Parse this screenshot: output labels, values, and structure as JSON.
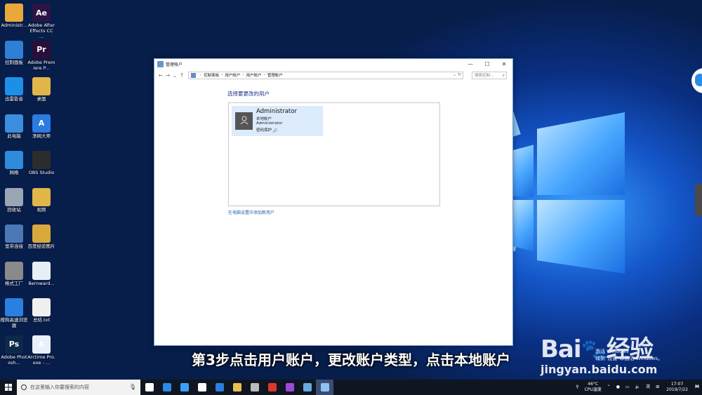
{
  "desktop": {
    "col1": [
      {
        "label": "Administr...",
        "icon": "user-folder-icon",
        "color": "#e8a93a",
        "text": ""
      },
      {
        "label": "控制面板",
        "icon": "control-panel-icon",
        "color": "#2f7fd6",
        "text": ""
      },
      {
        "label": "迅雷影音",
        "icon": "xunlei-player-icon",
        "color": "#1c8fe6",
        "text": ""
      },
      {
        "label": "此电脑",
        "icon": "this-pc-icon",
        "color": "#3b8ede",
        "text": ""
      },
      {
        "label": "网络",
        "icon": "network-icon",
        "color": "#2f8bdc",
        "text": ""
      },
      {
        "label": "回收站",
        "icon": "recycle-bin-icon",
        "color": "#9aa6b4",
        "text": ""
      },
      {
        "label": "宽带连接",
        "icon": "broadband-icon",
        "color": "#4c78b8",
        "text": ""
      },
      {
        "label": "格式工厂",
        "icon": "format-factory-icon",
        "color": "#8a8a8a",
        "text": ""
      },
      {
        "label": "搜狗高速浏览器",
        "icon": "sogou-browser-icon",
        "color": "#2a7fe0",
        "text": ""
      },
      {
        "label": "Adobe Photosh...",
        "icon": "photoshop-icon",
        "color": "#0b2a4a",
        "text": "Ps"
      }
    ],
    "col2": [
      {
        "label": "Adobe After Effects CC ...",
        "icon": "after-effects-icon",
        "color": "#2b1446",
        "text": "Ae"
      },
      {
        "label": "Adobe Premiere P...",
        "icon": "premiere-icon",
        "color": "#2a0f3a",
        "text": "Pr"
      },
      {
        "label": "桌面",
        "icon": "desktop-folder-icon",
        "color": "#e0b54a",
        "text": ""
      },
      {
        "label": "净网大师",
        "icon": "jingwang-icon",
        "color": "#2b7be0",
        "text": "A"
      },
      {
        "label": "OBS Studio",
        "icon": "obs-icon",
        "color": "#2c2c2c",
        "text": ""
      },
      {
        "label": "视频",
        "icon": "video-folder-icon",
        "color": "#e0b54a",
        "text": ""
      },
      {
        "label": "百度经验图片",
        "icon": "folder-icon",
        "color": "#d9a83c",
        "text": ""
      },
      {
        "label": "Bernward...",
        "icon": "bernward-icon",
        "color": "#e8eef5",
        "text": ""
      },
      {
        "label": "总结.txt",
        "icon": "text-file-icon",
        "color": "#f0f0f0",
        "text": ""
      },
      {
        "label": "Arctime Pro.exe - ...",
        "icon": "arctime-icon",
        "color": "#e8f0fa",
        "text": "A"
      }
    ]
  },
  "window": {
    "title": "管理帐户",
    "controls": {
      "minimize": "—",
      "maximize": "☐",
      "close": "✕"
    },
    "nav": {
      "back": "←",
      "forward": "→",
      "recent": "⌄",
      "up": "↑"
    },
    "breadcrumb": [
      "控制面板",
      "用户帐户",
      "用户帐户",
      "管理帐户"
    ],
    "address_dropdown": "⌄",
    "refresh": "↻",
    "search_placeholder": "搜索控制...",
    "heading": "选择要更改的用户",
    "account": {
      "name": "Administrator",
      "type": "本地帐户",
      "group": "Administrator",
      "protection": "密码保护"
    },
    "add_user_link": "在电脑设置中添加新用户"
  },
  "overlay": {
    "subtitle": "第3步点击用户账户，更改账户类型，点击本地账户",
    "activation_line1": "激活 Windows",
    "activation_line2": "转到\"设置\"以激活 Windows。",
    "baidu_logo": "Bai",
    "baidu_logo2": "经验",
    "baidu_url": "jingyan.baidu.com"
  },
  "taskbar": {
    "search_placeholder": "在这里输入你要搜索的内容",
    "apps": [
      {
        "name": "task-view",
        "color": "#ffffff",
        "active": false
      },
      {
        "name": "edge",
        "color": "#2a8ae6",
        "active": false
      },
      {
        "name": "xunlei",
        "color": "#3aa0ff",
        "active": false
      },
      {
        "name": "baidu-netdisk",
        "color": "#ffffff",
        "active": false
      },
      {
        "name": "sogou-browser",
        "color": "#2a7fe0",
        "active": false
      },
      {
        "name": "file-explorer",
        "color": "#e8c050",
        "active": false
      },
      {
        "name": "obs",
        "color": "#bbbbbb",
        "active": false
      },
      {
        "name": "wps",
        "color": "#d83a2a",
        "active": false
      },
      {
        "name": "premiere",
        "color": "#9a4ad8",
        "active": false
      },
      {
        "name": "control-panel-task",
        "color": "#6aa8e0",
        "active": false
      },
      {
        "name": "manage-accounts-task",
        "color": "#8fc2f0",
        "active": true
      }
    ],
    "temp": "46°C",
    "temp_label": "CPU温度",
    "ime": "英",
    "time": "17:07",
    "date": "2019/7/22"
  }
}
